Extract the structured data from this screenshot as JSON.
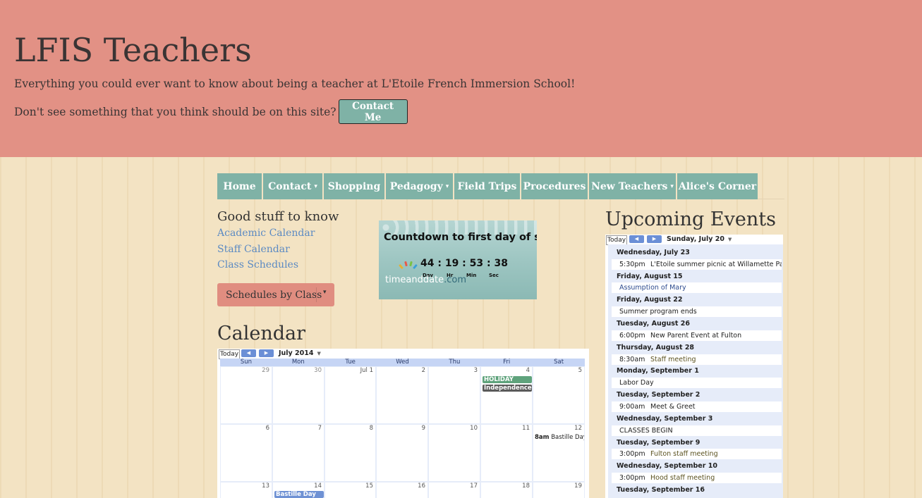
{
  "header": {
    "title": "LFIS Teachers",
    "tagline": "Everything you could ever want to know about being a teacher at L'Etoile French Immersion School!",
    "contact_prompt": "Don't see something that you think should be on this site?",
    "contact_button": "Contact Me"
  },
  "nav": {
    "items": [
      {
        "label": "Home",
        "dropdown": false
      },
      {
        "label": "Contact",
        "dropdown": true
      },
      {
        "label": "Shopping",
        "dropdown": false
      },
      {
        "label": "Pedagogy",
        "dropdown": true
      },
      {
        "label": "Field Trips",
        "dropdown": false
      },
      {
        "label": "Procedures",
        "dropdown": false
      },
      {
        "label": "New Teachers",
        "dropdown": true
      },
      {
        "label": "Alice's Corner",
        "dropdown": false
      }
    ],
    "caret": "▾"
  },
  "good_stuff": {
    "heading": "Good stuff to know",
    "links": [
      "Academic Calendar",
      "Staff Calendar",
      "Class Schedules"
    ],
    "schedules_button": "Schedules by Class"
  },
  "countdown": {
    "title": "Countdown to first day of school",
    "time": "44 : 19 : 53 : 38",
    "units": [
      "Day",
      "Hr",
      "Min",
      "Sec"
    ],
    "brand_a": "timeand",
    "brand_b": "date",
    "brand_c": ".com"
  },
  "calendar": {
    "heading": "Calendar",
    "today": "Today",
    "month": "July 2014",
    "weekdays": [
      "Sun",
      "Mon",
      "Tue",
      "Wed",
      "Thu",
      "Fri",
      "Sat"
    ],
    "weeks": [
      [
        "29",
        "30",
        "Jul 1",
        "2",
        "3",
        "4",
        "5"
      ],
      [
        "6",
        "7",
        "8",
        "9",
        "10",
        "11",
        "12"
      ],
      [
        "13",
        "14",
        "15",
        "16",
        "17",
        "18",
        "19"
      ]
    ],
    "events": {
      "holiday": "HOLIDAY",
      "independence": "Independence",
      "bastille_time": "8am",
      "bastille_title": "Bastille Day",
      "bastille_allday": "Bastille Day"
    }
  },
  "upcoming": {
    "heading": "Upcoming Events",
    "today": "Today",
    "date": "Sunday, July 20",
    "agenda": [
      {
        "date": "Wednesday, July 23",
        "time": "5:30pm",
        "title": "L'Etoile summer picnic at Willamette Park",
        "style": "plain"
      },
      {
        "date": "Friday, August 15",
        "time": "",
        "title": "Assumption of Mary",
        "style": "link-blue"
      },
      {
        "date": "Friday, August 22",
        "time": "",
        "title": "Summer program ends",
        "style": "plain"
      },
      {
        "date": "Tuesday, August 26",
        "time": "6:00pm",
        "title": "New Parent Event at Fulton",
        "style": "plain"
      },
      {
        "date": "Thursday, August 28",
        "time": "8:30am",
        "title": "Staff meeting",
        "style": "olive"
      },
      {
        "date": "Monday, September 1",
        "time": "",
        "title": "Labor Day",
        "style": "plain"
      },
      {
        "date": "Tuesday, September 2",
        "time": "9:00am",
        "title": "Meet & Greet",
        "style": "plain"
      },
      {
        "date": "Wednesday, September 3",
        "time": "",
        "title": "CLASSES BEGIN",
        "style": "plain"
      },
      {
        "date": "Tuesday, September 9",
        "time": "3:00pm",
        "title": "Fulton staff meeting",
        "style": "olive"
      },
      {
        "date": "Wednesday, September 10",
        "time": "3:00pm",
        "title": "Hood staff meeting",
        "style": "olive"
      },
      {
        "date": "Tuesday, September 16",
        "time": "",
        "title": "",
        "style": "plain"
      }
    ]
  },
  "colors": {
    "header_bg": "#e29185",
    "nav_bg": "#7fb2a6",
    "link": "#5b8ac3",
    "button_salmon": "#e08d80",
    "page_bg": "#f3e3c3"
  }
}
